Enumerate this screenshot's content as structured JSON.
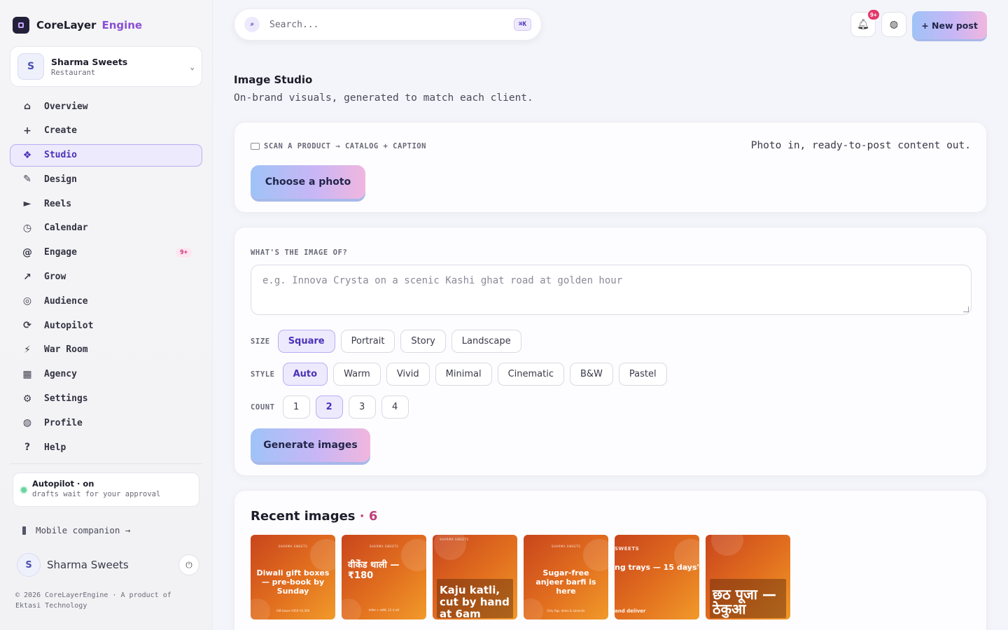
{
  "brand": {
    "name": "CoreLayer",
    "accent": "Engine"
  },
  "workspace": {
    "initial": "S",
    "name": "Sharma Sweets",
    "type": "Restaurant"
  },
  "nav": [
    {
      "icon": "⌂",
      "label": "Overview"
    },
    {
      "icon": "+",
      "label": "Create"
    },
    {
      "icon": "❖",
      "label": "Studio",
      "active": true
    },
    {
      "icon": "✎",
      "label": "Design"
    },
    {
      "icon": "►",
      "label": "Reels"
    },
    {
      "icon": "◷",
      "label": "Calendar"
    },
    {
      "icon": "@",
      "label": "Engage",
      "badge": "9+"
    },
    {
      "icon": "↗",
      "label": "Grow"
    },
    {
      "icon": "◎",
      "label": "Audience"
    },
    {
      "icon": "⟳",
      "label": "Autopilot"
    },
    {
      "icon": "⚡",
      "label": "War Room"
    },
    {
      "icon": "▦",
      "label": "Agency"
    },
    {
      "icon": "⚙",
      "label": "Settings"
    },
    {
      "icon": "◍",
      "label": "Profile"
    },
    {
      "icon": "?",
      "label": "Help"
    }
  ],
  "autopilot": {
    "title": "Autopilot · on",
    "subtitle": "drafts wait for your approval"
  },
  "mobile_link": "Mobile companion →",
  "user": {
    "initial": "S",
    "name": "Sharma Sweets"
  },
  "copyright": "© 2026 CoreLayerEngine · A product of Ektasi Technology",
  "search": {
    "placeholder": "Search...",
    "shortcut": "⌘K"
  },
  "notifications_badge": "9+",
  "new_post_label": "+ New post",
  "page": {
    "title": "Image Studio",
    "subtitle": "On-brand visuals, generated to match each client."
  },
  "scan": {
    "label": "SCAN A PRODUCT → CATALOG + CAPTION",
    "tagline": "Photo in, ready-to-post content out.",
    "button": "Choose a photo"
  },
  "form": {
    "question": "WHAT'S THE IMAGE OF?",
    "placeholder": "e.g. Innova Crysta on a scenic Kashi ghat road at golden hour",
    "size_label": "SIZE",
    "sizes": [
      "Square",
      "Portrait",
      "Story",
      "Landscape"
    ],
    "size_selected": "Square",
    "style_label": "STYLE",
    "styles": [
      "Auto",
      "Warm",
      "Vivid",
      "Minimal",
      "Cinematic",
      "B&W",
      "Pastel"
    ],
    "style_selected": "Auto",
    "count_label": "COUNT",
    "counts": [
      "1",
      "2",
      "3",
      "4"
    ],
    "count_selected": "2",
    "generate_label": "Generate images"
  },
  "recent": {
    "title": "Recent images",
    "count": "· 6",
    "images": [
      {
        "brand": "SHARMA SWEETS",
        "text": "Diwali gift boxes — pre-book by Sunday",
        "foot": "Gift boxes ₹450–₹2,500"
      },
      {
        "brand": "SHARMA SWEETS",
        "text": "वीकेंड थाली — ₹180",
        "foot": "समोसा + जलेबी, 12–4 बजे"
      },
      {
        "brand": "SHARMA SWEETS",
        "text": "Kaju katli, cut by hand at 6am"
      },
      {
        "brand": "SHARMA SWEETS",
        "text": "Sugar-free anjeer barfi is here",
        "foot": "Only figs, dates & almonds"
      },
      {
        "brand": "SWEETS",
        "text": "ng trays — 15 days'",
        "foot": "and deliver"
      },
      {
        "text": "छठ पूजा — ठेकुआ"
      }
    ]
  }
}
